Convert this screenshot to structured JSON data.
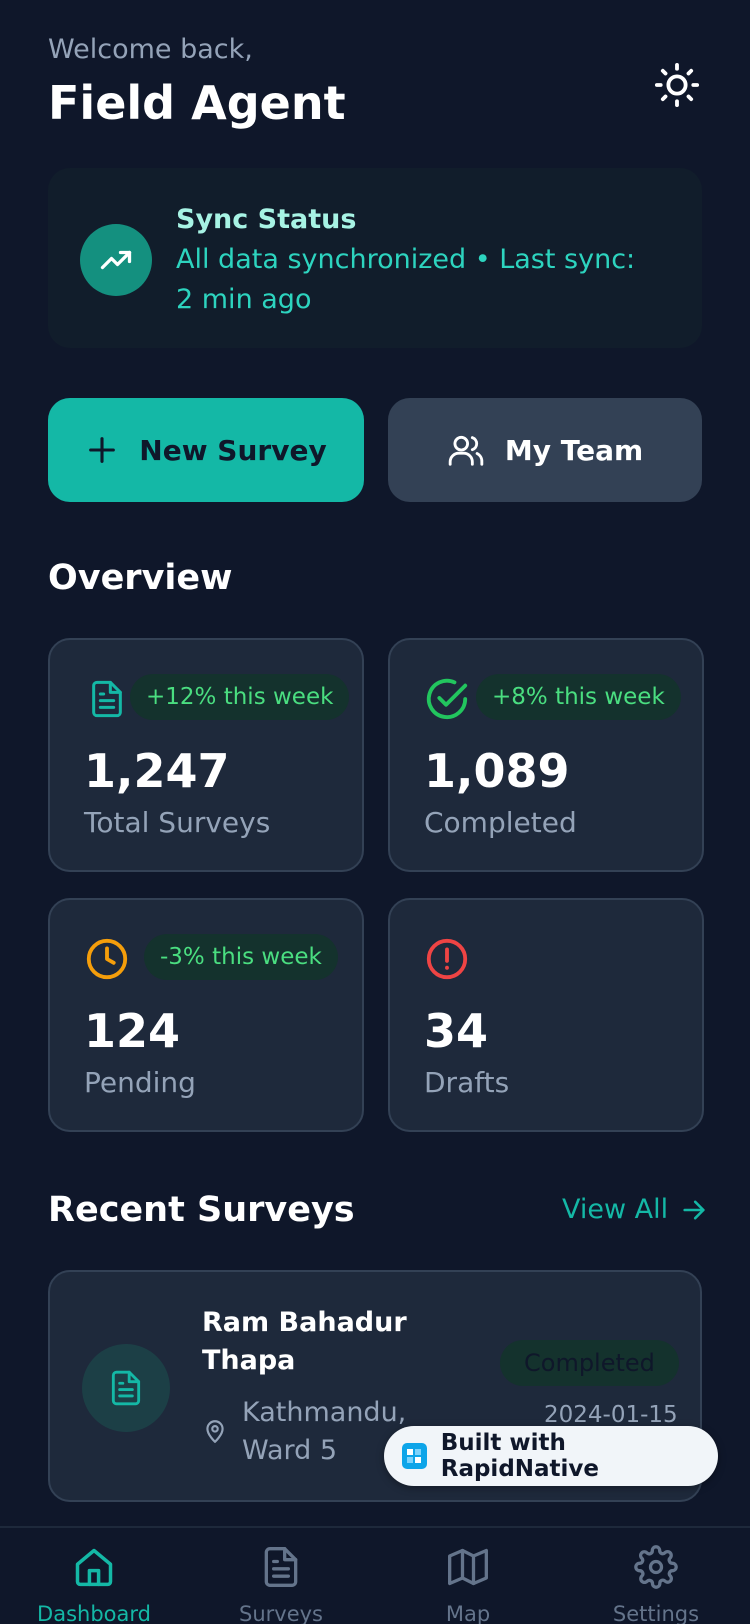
{
  "header": {
    "welcome": "Welcome back,",
    "user_name": "Field Agent",
    "theme_icon": "sun-icon"
  },
  "sync": {
    "title": "Sync Status",
    "message": "All data synchronized • Last sync: 2 min ago",
    "icon": "trending-up-icon"
  },
  "actions": {
    "new_survey": "New Survey",
    "my_team": "My Team"
  },
  "overview": {
    "title": "Overview",
    "stats": [
      {
        "value": "1,247",
        "label": "Total Surveys",
        "badge": "+12% this week",
        "icon": "file-text-icon",
        "color": "#14b8a6"
      },
      {
        "value": "1,089",
        "label": "Completed",
        "badge": "+8% this week",
        "icon": "check-circle-icon",
        "color": "#22c55e"
      },
      {
        "value": "124",
        "label": "Pending",
        "badge": "-3% this week",
        "icon": "clock-icon",
        "color": "#f59e0b"
      },
      {
        "value": "34",
        "label": "Drafts",
        "badge": "",
        "icon": "alert-circle-icon",
        "color": "#ef4444"
      }
    ]
  },
  "recent": {
    "title": "Recent Surveys",
    "view_all": "View All",
    "items": [
      {
        "name": "Ram Bahadur Thapa",
        "location": "Kathmandu, Ward 5",
        "status": "Completed",
        "date": "2024-01-15"
      }
    ]
  },
  "badge": {
    "text": "Built with RapidNative"
  },
  "nav": {
    "items": [
      {
        "label": "Dashboard",
        "icon": "home-icon",
        "active": true
      },
      {
        "label": "Surveys",
        "icon": "file-text-icon"
      },
      {
        "label": "Map",
        "icon": "map-icon"
      },
      {
        "label": "Settings",
        "icon": "settings-icon"
      }
    ]
  },
  "colors": {
    "background": "#0f172a",
    "card": "#1e293b",
    "accent": "#14b8a6",
    "positive": "#4ade80"
  }
}
